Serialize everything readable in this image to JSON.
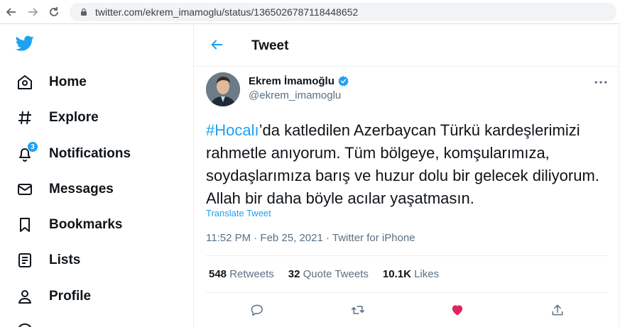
{
  "browser": {
    "url": "twitter.com/ekrem_imamoglu/status/1365026787118448652"
  },
  "sidebar": {
    "items": [
      {
        "label": "Home",
        "icon": "home-icon"
      },
      {
        "label": "Explore",
        "icon": "hashtag-icon"
      },
      {
        "label": "Notifications",
        "icon": "bell-icon",
        "badge": "3"
      },
      {
        "label": "Messages",
        "icon": "envelope-icon"
      },
      {
        "label": "Bookmarks",
        "icon": "bookmark-icon"
      },
      {
        "label": "Lists",
        "icon": "list-icon"
      },
      {
        "label": "Profile",
        "icon": "person-icon"
      }
    ]
  },
  "header": {
    "title": "Tweet"
  },
  "tweet": {
    "author_name": "Ekrem İmamoğlu",
    "author_handle": "@ekrem_imamoglu",
    "hashtag": "#Hocalı",
    "text": "’da katledilen Azerbaycan Türkü kardeşlerimizi rahmetle anıyorum. Tüm bölgeye, komşularımıza, soydaşlarımıza barış ve huzur dolu bir gelecek diliyorum. Allah bir daha böyle acılar yaşatmasın.",
    "translate_label": "Translate Tweet",
    "meta": "11:52 PM · Feb 25, 2021 · Twitter for iPhone",
    "retweets_count": "548",
    "retweets_label": "Retweets",
    "quotes_count": "32",
    "quotes_label": "Quote Tweets",
    "likes_count": "10.1K",
    "likes_label": "Likes"
  },
  "colors": {
    "accent": "#1da1f2",
    "like": "#e0245e",
    "secondary_text": "#5b7083"
  }
}
